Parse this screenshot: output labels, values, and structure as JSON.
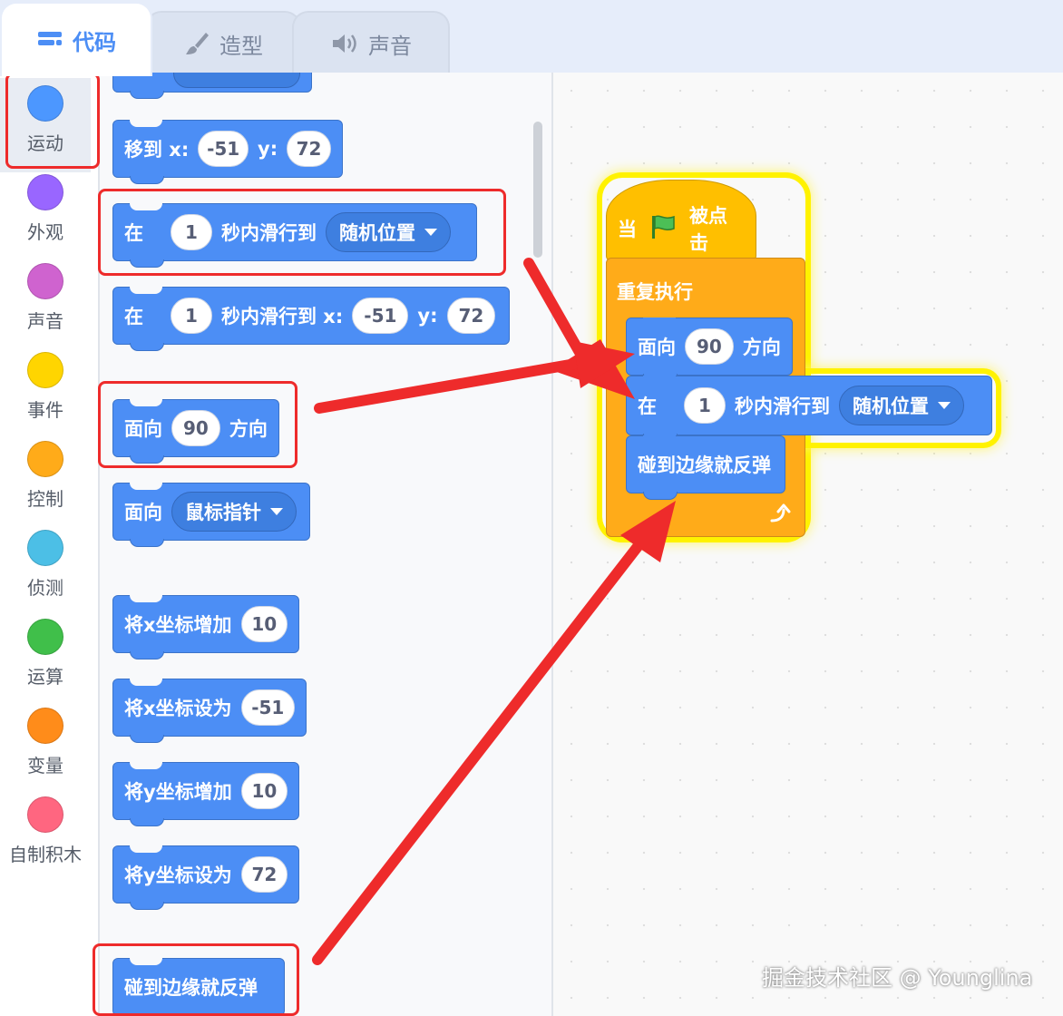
{
  "tabs": [
    {
      "label": "代码",
      "icon": "code-icon"
    },
    {
      "label": "造型",
      "icon": "brush-icon"
    },
    {
      "label": "声音",
      "icon": "speaker-icon"
    }
  ],
  "categories": [
    {
      "label": "运动",
      "color": "#4c97ff"
    },
    {
      "label": "外观",
      "color": "#9966ff"
    },
    {
      "label": "声音",
      "color": "#cf63cf"
    },
    {
      "label": "事件",
      "color": "#ffd500"
    },
    {
      "label": "控制",
      "color": "#ffab19"
    },
    {
      "label": "侦测",
      "color": "#4cbfe6"
    },
    {
      "label": "运算",
      "color": "#40bf4a"
    },
    {
      "label": "变量",
      "color": "#ff8c1a"
    },
    {
      "label": "自制积木",
      "color": "#ff6680"
    }
  ],
  "palette": {
    "goto": {
      "label": "移到 x:",
      "x": "-51",
      "ylabel": "y:",
      "y": "72"
    },
    "glide_random": {
      "pre": "在",
      "secs": "1",
      "mid": "秒内滑行到",
      "dest": "随机位置"
    },
    "glide_xy": {
      "pre": "在",
      "secs": "1",
      "mid": "秒内滑行到 x:",
      "x": "-51",
      "ylabel": "y:",
      "y": "72"
    },
    "point_dir": {
      "pre": "面向",
      "deg": "90",
      "post": "方向"
    },
    "point_towards": {
      "pre": "面向",
      "target": "鼠标指针"
    },
    "change_x": {
      "label": "将x坐标增加",
      "val": "10"
    },
    "set_x": {
      "label": "将x坐标设为",
      "val": "-51"
    },
    "change_y": {
      "label": "将y坐标增加",
      "val": "10"
    },
    "set_y": {
      "label": "将y坐标设为",
      "val": "72"
    },
    "bounce": {
      "label": "碰到边缘就反弹"
    }
  },
  "script": {
    "hat": {
      "pre": "当",
      "post": "被点击"
    },
    "forever": {
      "label": "重复执行"
    },
    "point_dir": {
      "pre": "面向",
      "deg": "90",
      "post": "方向"
    },
    "glide_random": {
      "pre": "在",
      "secs": "1",
      "mid": "秒内滑行到",
      "dest": "随机位置"
    },
    "bounce": {
      "label": "碰到边缘就反弹"
    }
  },
  "watermark": "掘金技术社区 @ Younglina",
  "colors": {
    "motion": "#4c8ef5",
    "event": "#ffbf00",
    "control": "#ffab19",
    "highlight": "#fff200",
    "annotation": "#ee2b2b"
  }
}
